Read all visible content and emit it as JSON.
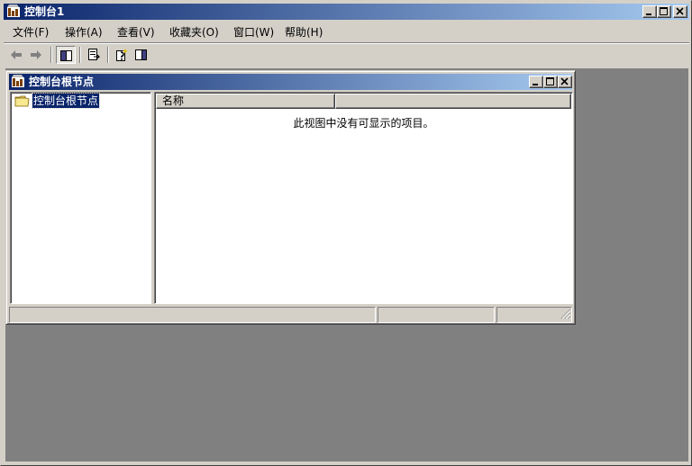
{
  "app": {
    "title": "控制台1",
    "icon": "mmc-console-icon"
  },
  "window_controls": {
    "minimize_icon": "minimize-icon",
    "maximize_icon": "maximize-icon",
    "close_icon": "close-icon"
  },
  "menu": {
    "items": [
      {
        "label": "文件(F)"
      },
      {
        "label": "操作(A)"
      },
      {
        "label": "查看(V)"
      },
      {
        "label": "收藏夹(O)"
      },
      {
        "label": "窗口(W)"
      },
      {
        "label": "帮助(H)"
      }
    ]
  },
  "toolbar": {
    "buttons": [
      {
        "icon": "back-arrow-icon"
      },
      {
        "icon": "forward-arrow-icon"
      },
      {
        "icon": "show-hide-tree-icon"
      },
      {
        "icon": "export-list-icon"
      },
      {
        "icon": "help-icon"
      },
      {
        "icon": "show-hide-action-pane-icon"
      }
    ]
  },
  "child_window": {
    "title": "控制台根节点",
    "tree": {
      "root_label": "控制台根节点",
      "root_icon": "folder-icon"
    },
    "list": {
      "columns": [
        {
          "label": "名称"
        },
        {
          "label": ""
        }
      ],
      "empty_message": "此视图中没有可显示的项目。"
    },
    "status_bar": {
      "cells": [
        "",
        "",
        ""
      ]
    }
  },
  "colors": {
    "title_gradient_start": "#0a246a",
    "title_gradient_end": "#a6caf0",
    "face": "#d4d0c8",
    "workspace": "#808080",
    "selection": "#0a246a"
  }
}
